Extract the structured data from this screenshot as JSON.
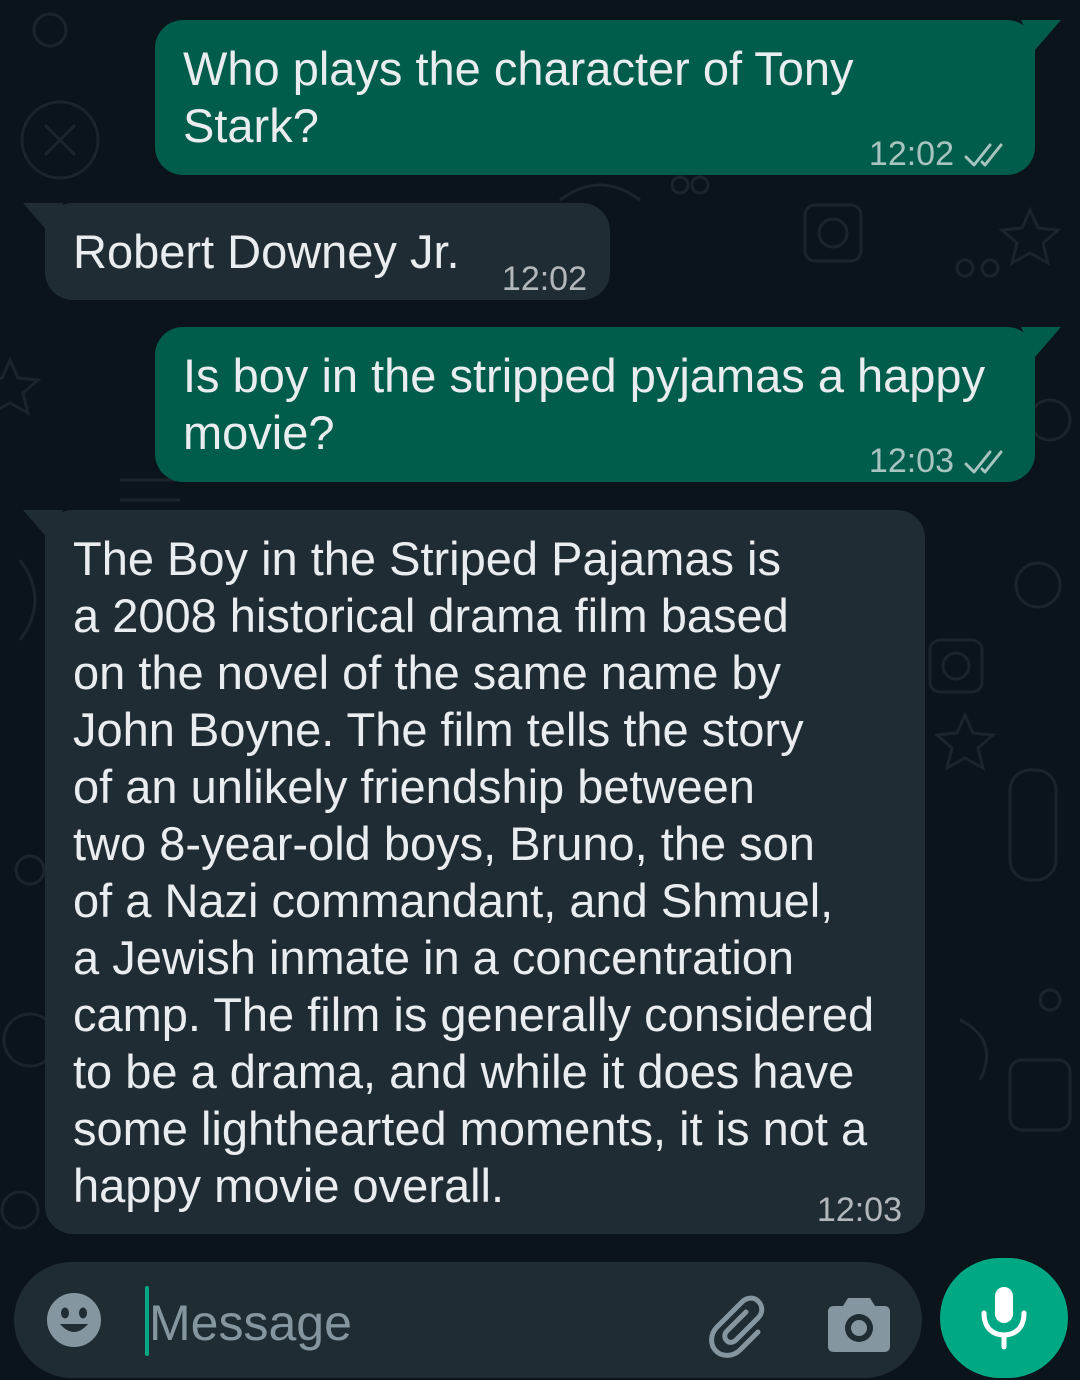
{
  "messages": [
    {
      "direction": "outgoing",
      "text": "Who plays the character of Tony\nStark?",
      "time": "12:02",
      "status": "read"
    },
    {
      "direction": "incoming",
      "text": "Robert Downey Jr.",
      "time": "12:02"
    },
    {
      "direction": "outgoing",
      "text": "Is boy in the stripped pyjamas a happy\nmovie?",
      "time": "12:03",
      "status": "read"
    },
    {
      "direction": "incoming",
      "text": "The Boy in the Striped Pajamas is\na 2008 historical drama film based\non the novel of the same name by\nJohn Boyne. The film tells the story\nof an unlikely friendship between\ntwo 8-year-old boys, Bruno, the son\nof a Nazi commandant, and Shmuel,\na Jewish inmate in a concentration\ncamp. The film is generally considered\nto be a drama, and while it does have\nsome lighthearted moments, it is not a\nhappy movie overall.",
      "time": "12:03"
    }
  ],
  "composer": {
    "placeholder": "Message",
    "icons": [
      "emoji-icon",
      "attach-icon",
      "camera-icon",
      "mic-icon"
    ]
  },
  "colors": {
    "background": "#0b141a",
    "outgoing_bubble": "#005c4b",
    "incoming_bubble": "#202c33",
    "accent": "#00a884",
    "text": "#e9edef",
    "secondary_text": "#8696a0"
  }
}
